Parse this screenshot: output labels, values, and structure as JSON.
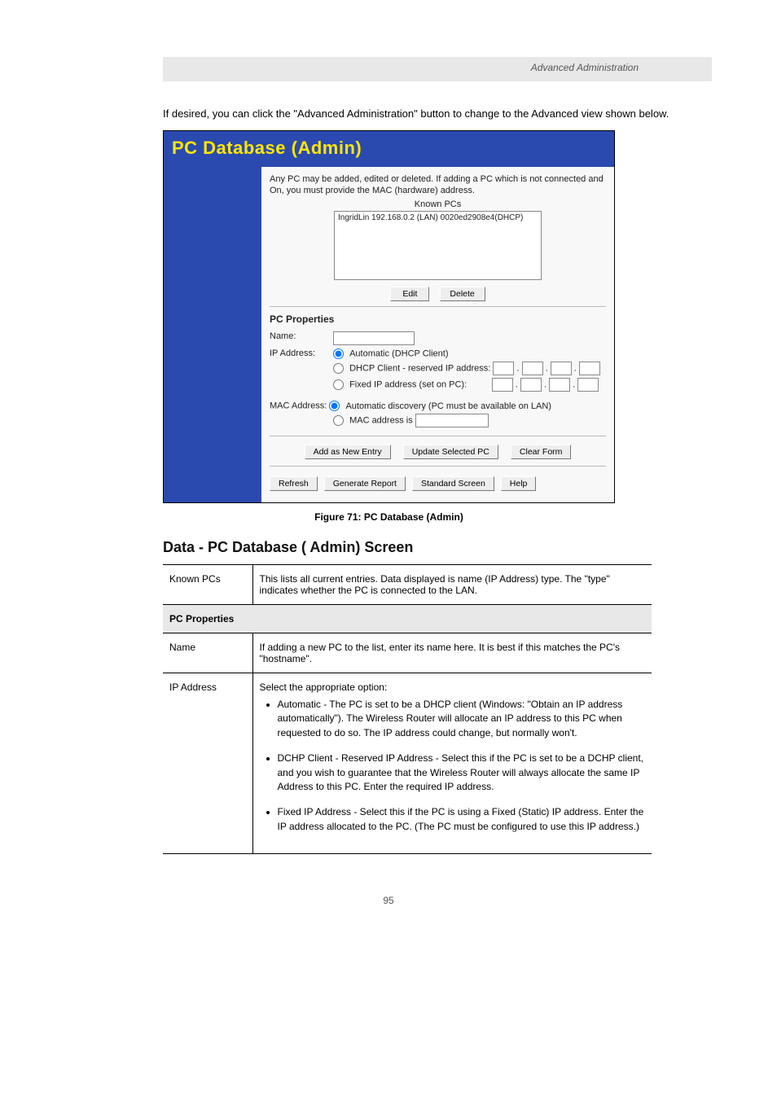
{
  "header": {
    "right": "Advanced Administration"
  },
  "intro_paragraph": "If desired, you can click the \"Advanced Administration\" button to change to the Advanced view shown below.",
  "panel": {
    "title": "PC Database (Admin)",
    "description": "Any PC may be added, edited or deleted. If adding a PC which is not connected and On, you must provide the MAC (hardware) address.",
    "known_pcs_label": "Known PCs",
    "known_pcs_item": "IngridLin 192.168.0.2 (LAN) 0020ed2908e4(DHCP)",
    "edit_btn": "Edit",
    "delete_btn": "Delete",
    "section_title": "PC Properties",
    "name_label": "Name:",
    "ip_label": "IP Address:",
    "ip_option_auto": "Automatic (DHCP Client)",
    "ip_option_reserved": "DHCP Client - reserved IP address:",
    "ip_option_fixed": "Fixed IP address (set on PC):",
    "mac_label": "MAC Address:",
    "mac_option_auto": "Automatic discovery (PC must be available on LAN)",
    "mac_option_manual": "MAC address is",
    "add_btn": "Add as New Entry",
    "update_btn": "Update Selected PC",
    "clear_btn": "Clear Form",
    "refresh_btn": "Refresh",
    "report_btn": "Generate Report",
    "standard_btn": "Standard Screen",
    "help_btn": "Help"
  },
  "figure_caption": "Figure 71: PC Database (Admin)",
  "table_heading": "Data - PC Database ( Admin) Screen",
  "table": {
    "row1_label": "Known PCs",
    "row1_text": "This lists all current entries. Data displayed is name (IP Address) type. The \"type\" indicates whether the PC is connected to the LAN.",
    "section_header": "PC Properties",
    "row2_label": "Name",
    "row2_text": "If adding a new PC to the list, enter its name here. It is best if this matches the PC's \"hostname\".",
    "row3_label": "IP Address",
    "row3_intro": "Select the appropriate option:",
    "row3_bullets": [
      "Automatic - The PC is set to be a DHCP client (Windows: \"Obtain an IP address automatically\"). The Wireless Router will allocate an IP address to this PC when requested to do so. The IP address could change, but normally won't.",
      "DCHP Client - Reserved IP Address - Select this if the PC is set to be a DCHP client, and you wish to guarantee that the Wireless Router will always allocate the same IP Address to this PC. Enter the required IP address.",
      "Fixed IP Address - Select this if the PC is using a Fixed (Static) IP address. Enter the IP address allocated to the PC. (The PC must be configured to use this IP address.)"
    ]
  },
  "page_number": "95"
}
